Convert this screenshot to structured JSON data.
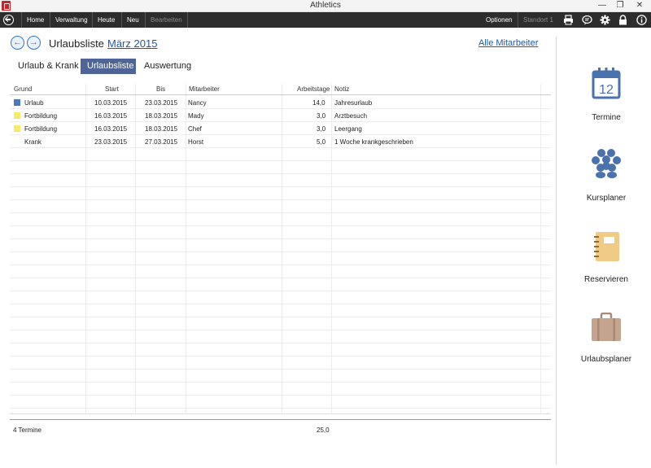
{
  "window": {
    "title": "Athletics",
    "restore_glyph": "❐",
    "close_glyph": "✕"
  },
  "toolbar": {
    "items": [
      "Home",
      "Verwaltung",
      "Heute",
      "Neu",
      "Bearbeiten"
    ],
    "options": "Optionen",
    "location": "Standort 1",
    "icons": [
      "printer-icon",
      "chat-icon",
      "gear-icon",
      "lock-icon",
      "info-icon"
    ]
  },
  "header": {
    "title": "Urlaubsliste",
    "period": "März 2015",
    "all_employees": "Alle Mitarbeiter"
  },
  "tabs": [
    {
      "label": "Urlaub & Krank",
      "active": false
    },
    {
      "label": "Urlaubsliste",
      "active": true
    },
    {
      "label": "Auswertung",
      "active": false
    }
  ],
  "table": {
    "columns": [
      "Grund",
      "Start",
      "Bis",
      "Mitarbeiter",
      "Arbeitstage",
      "Notiz"
    ],
    "rows": [
      {
        "grund": "Urlaub",
        "color": "#4a7ab7",
        "start": "10.03.2015",
        "bis": "23.03.2015",
        "mitarbeiter": "Nancy",
        "tage": "14,0",
        "notiz": "Jahresurlaub"
      },
      {
        "grund": "Fortbildung",
        "color": "#f7e96b",
        "start": "16.03.2015",
        "bis": "18.03.2015",
        "mitarbeiter": "Mady",
        "tage": "3,0",
        "notiz": "Arztbesuch"
      },
      {
        "grund": "Fortbildung",
        "color": "#f7e96b",
        "start": "16.03.2015",
        "bis": "18.03.2015",
        "mitarbeiter": "Chef",
        "tage": "3,0",
        "notiz": "Leergang"
      },
      {
        "grund": "Krank",
        "color": "",
        "start": "23.03.2015",
        "bis": "27.03.2015",
        "mitarbeiter": "Horst",
        "tage": "5,0",
        "notiz": "1 Woche krankgeschrieben"
      }
    ]
  },
  "footer": {
    "count": "4 Termine",
    "total": "25,0"
  },
  "sidebar": [
    {
      "label": "Termine",
      "icon": "calendar-icon",
      "day": "12"
    },
    {
      "label": "Kursplaner",
      "icon": "group-icon"
    },
    {
      "label": "Reservieren",
      "icon": "notebook-icon"
    },
    {
      "label": "Urlaubsplaner",
      "icon": "suitcase-icon"
    }
  ],
  "colors": {
    "accent": "#4f6597",
    "link": "#1d5aa8",
    "toolbar": "#2d2d2d"
  }
}
